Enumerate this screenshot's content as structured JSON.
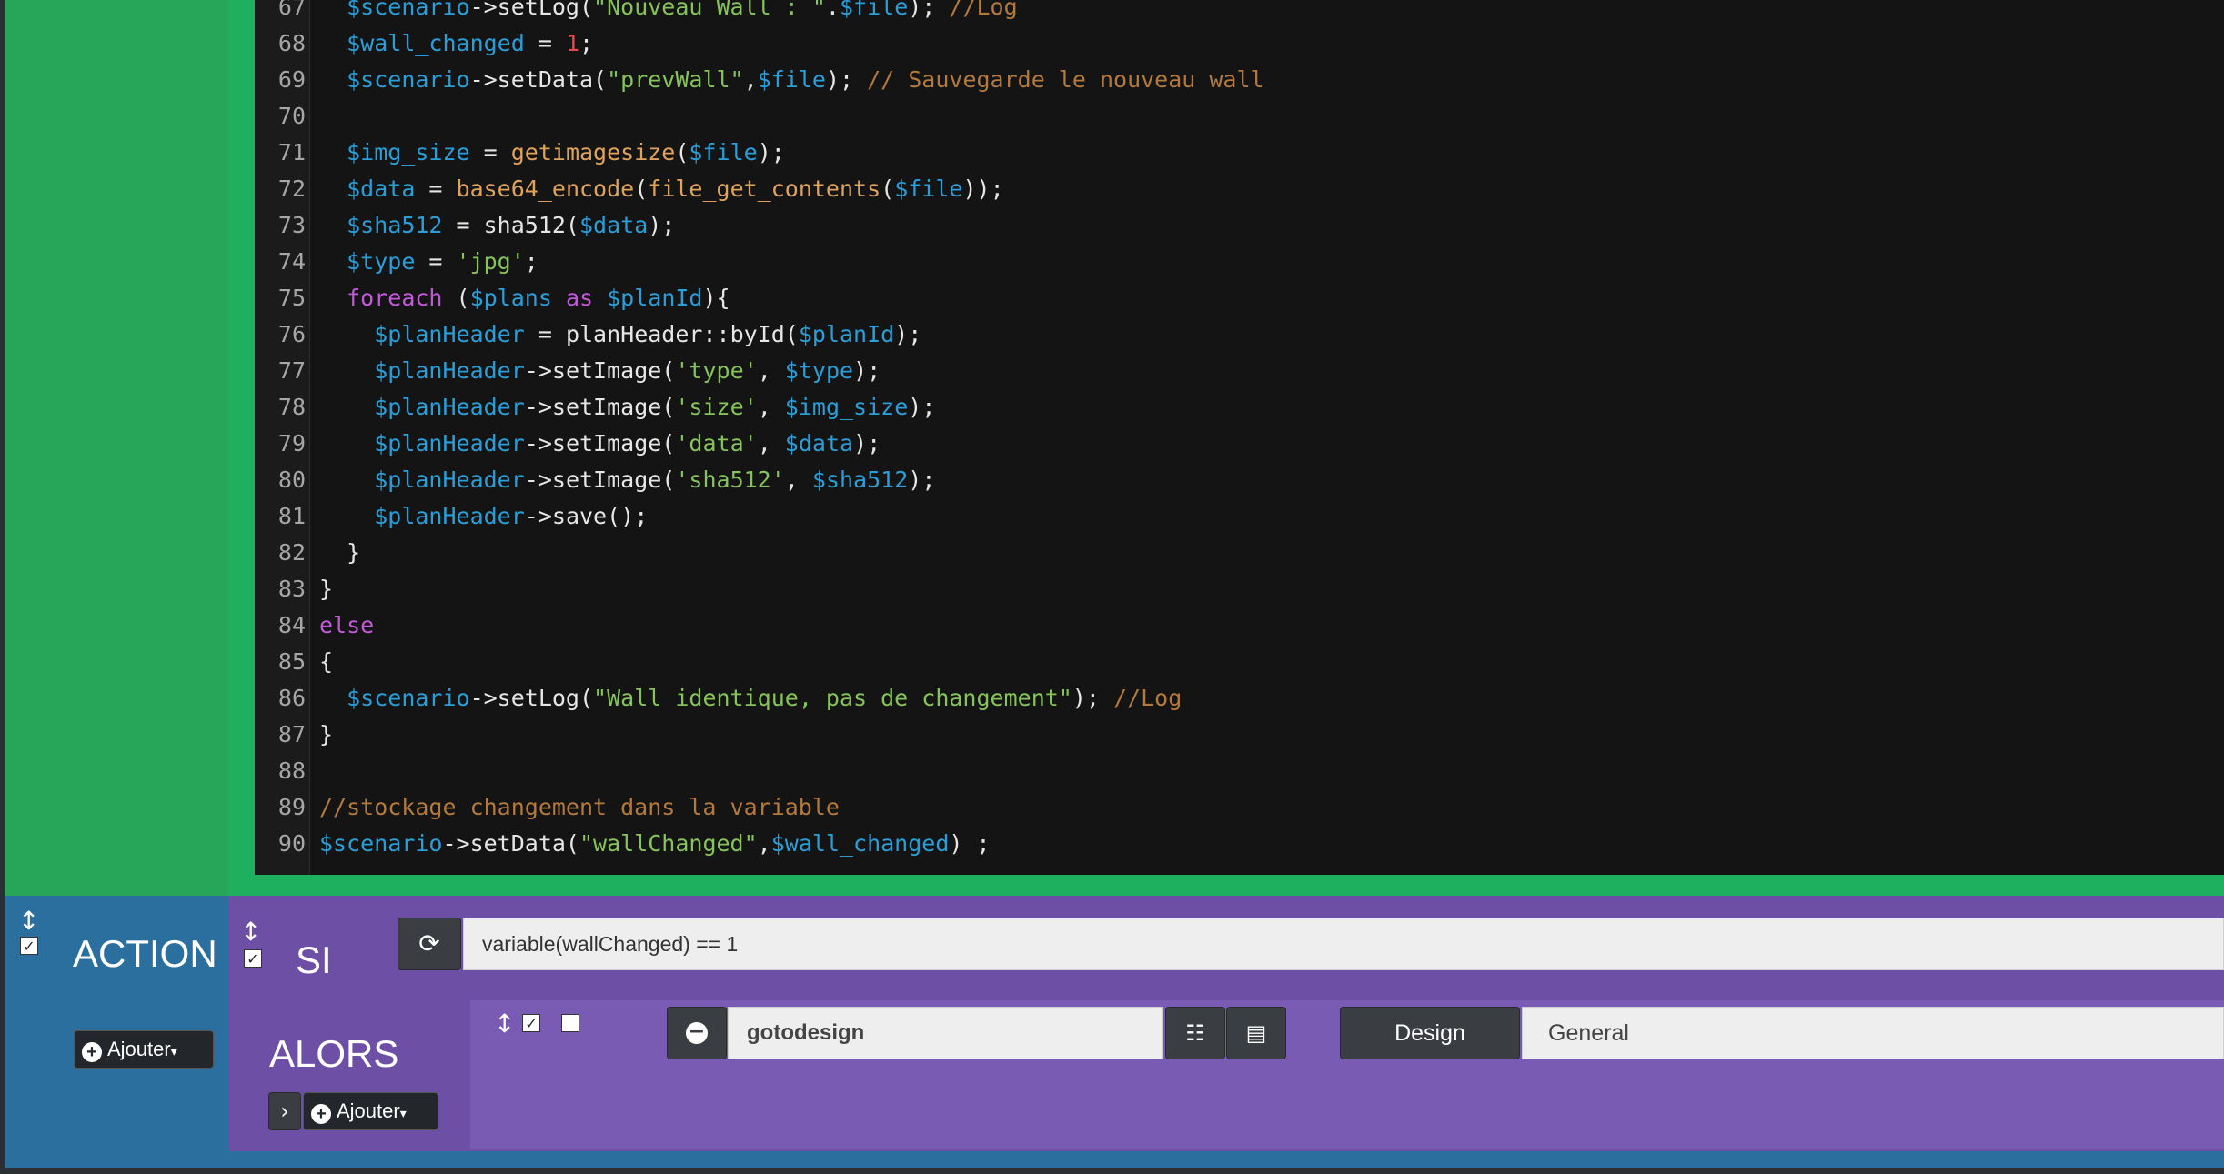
{
  "code_lines": [
    {
      "n": "67",
      "html": "  <span class=\"v\">$scenario</span>-&gt;setLog(<span class=\"s\">\"Nouveau Wall : \"</span>.<span class=\"v\">$file</span>); <span class=\"c\">//Log</span>"
    },
    {
      "n": "68",
      "html": "  <span class=\"v\">$wall_changed</span> = <span class=\"n\">1</span>;"
    },
    {
      "n": "69",
      "html": "  <span class=\"v\">$scenario</span>-&gt;setData(<span class=\"s\">\"prevWall\"</span>,<span class=\"v\">$file</span>); <span class=\"c\">// Sauvegarde le nouveau wall</span>"
    },
    {
      "n": "70",
      "html": ""
    },
    {
      "n": "71",
      "html": "  <span class=\"v\">$img_size</span> = <span class=\"f\">getimagesize</span>(<span class=\"v\">$file</span>);"
    },
    {
      "n": "72",
      "html": "  <span class=\"v\">$data</span> = <span class=\"f\">base64_encode</span>(<span class=\"f\">file_get_contents</span>(<span class=\"v\">$file</span>));"
    },
    {
      "n": "73",
      "html": "  <span class=\"v\">$sha512</span> = sha512(<span class=\"v\">$data</span>);"
    },
    {
      "n": "74",
      "html": "  <span class=\"v\">$type</span> = <span class=\"s\">'jpg'</span>;"
    },
    {
      "n": "75",
      "html": "  <span class=\"k\">foreach</span> (<span class=\"v\">$plans</span> <span class=\"k\">as</span> <span class=\"v\">$planId</span>){"
    },
    {
      "n": "76",
      "html": "    <span class=\"v\">$planHeader</span> = planHeader::byId(<span class=\"v\">$planId</span>);"
    },
    {
      "n": "77",
      "html": "    <span class=\"v\">$planHeader</span>-&gt;setImage(<span class=\"s\">'type'</span>, <span class=\"v\">$type</span>);"
    },
    {
      "n": "78",
      "html": "    <span class=\"v\">$planHeader</span>-&gt;setImage(<span class=\"s\">'size'</span>, <span class=\"v\">$img_size</span>);"
    },
    {
      "n": "79",
      "html": "    <span class=\"v\">$planHeader</span>-&gt;setImage(<span class=\"s\">'data'</span>, <span class=\"v\">$data</span>);"
    },
    {
      "n": "80",
      "html": "    <span class=\"v\">$planHeader</span>-&gt;setImage(<span class=\"s\">'sha512'</span>, <span class=\"v\">$sha512</span>);"
    },
    {
      "n": "81",
      "html": "    <span class=\"v\">$planHeader</span>-&gt;save();"
    },
    {
      "n": "82",
      "html": "  }"
    },
    {
      "n": "83",
      "html": "}"
    },
    {
      "n": "84",
      "html": "<span class=\"k\">else</span>"
    },
    {
      "n": "85",
      "html": "{"
    },
    {
      "n": "86",
      "html": "  <span class=\"v\">$scenario</span>-&gt;setLog(<span class=\"s\">\"Wall identique, pas de changement\"</span>); <span class=\"c\">//Log</span>"
    },
    {
      "n": "87",
      "html": "}"
    },
    {
      "n": "88",
      "html": ""
    },
    {
      "n": "89",
      "html": "<span class=\"c\">//stockage changement dans la variable</span>"
    },
    {
      "n": "90",
      "html": "<span class=\"v\">$scenario</span>-&gt;setData(<span class=\"s\">\"wallChanged\"</span>,<span class=\"v\">$wall_changed</span>) ;"
    }
  ],
  "action": {
    "title": "ACTION",
    "add_label": "Ajouter"
  },
  "si": {
    "title": "SI",
    "condition": "variable(wallChanged) == 1"
  },
  "alors": {
    "title": "ALORS",
    "add_label": "Ajouter",
    "action_cmd": "gotodesign",
    "design_label": "Design",
    "design_value": "General"
  },
  "icons": {
    "move": "move-vertical-icon",
    "refresh": "refresh-icon",
    "remove": "minus-circle-icon",
    "list": "list-check-icon",
    "detail": "list-icon",
    "chevron": "chevron-right-icon",
    "add": "plus-circle-icon"
  },
  "colors": {
    "code_bg": "#141414",
    "green": "#27a65a",
    "action_blue": "#2a6f9d",
    "purple": "#6e4fa6",
    "purple_light": "#7a5bb4",
    "variable": "#2a9ed8",
    "string": "#86c35a",
    "comment": "#b4793c",
    "keyword": "#c25ad8"
  }
}
